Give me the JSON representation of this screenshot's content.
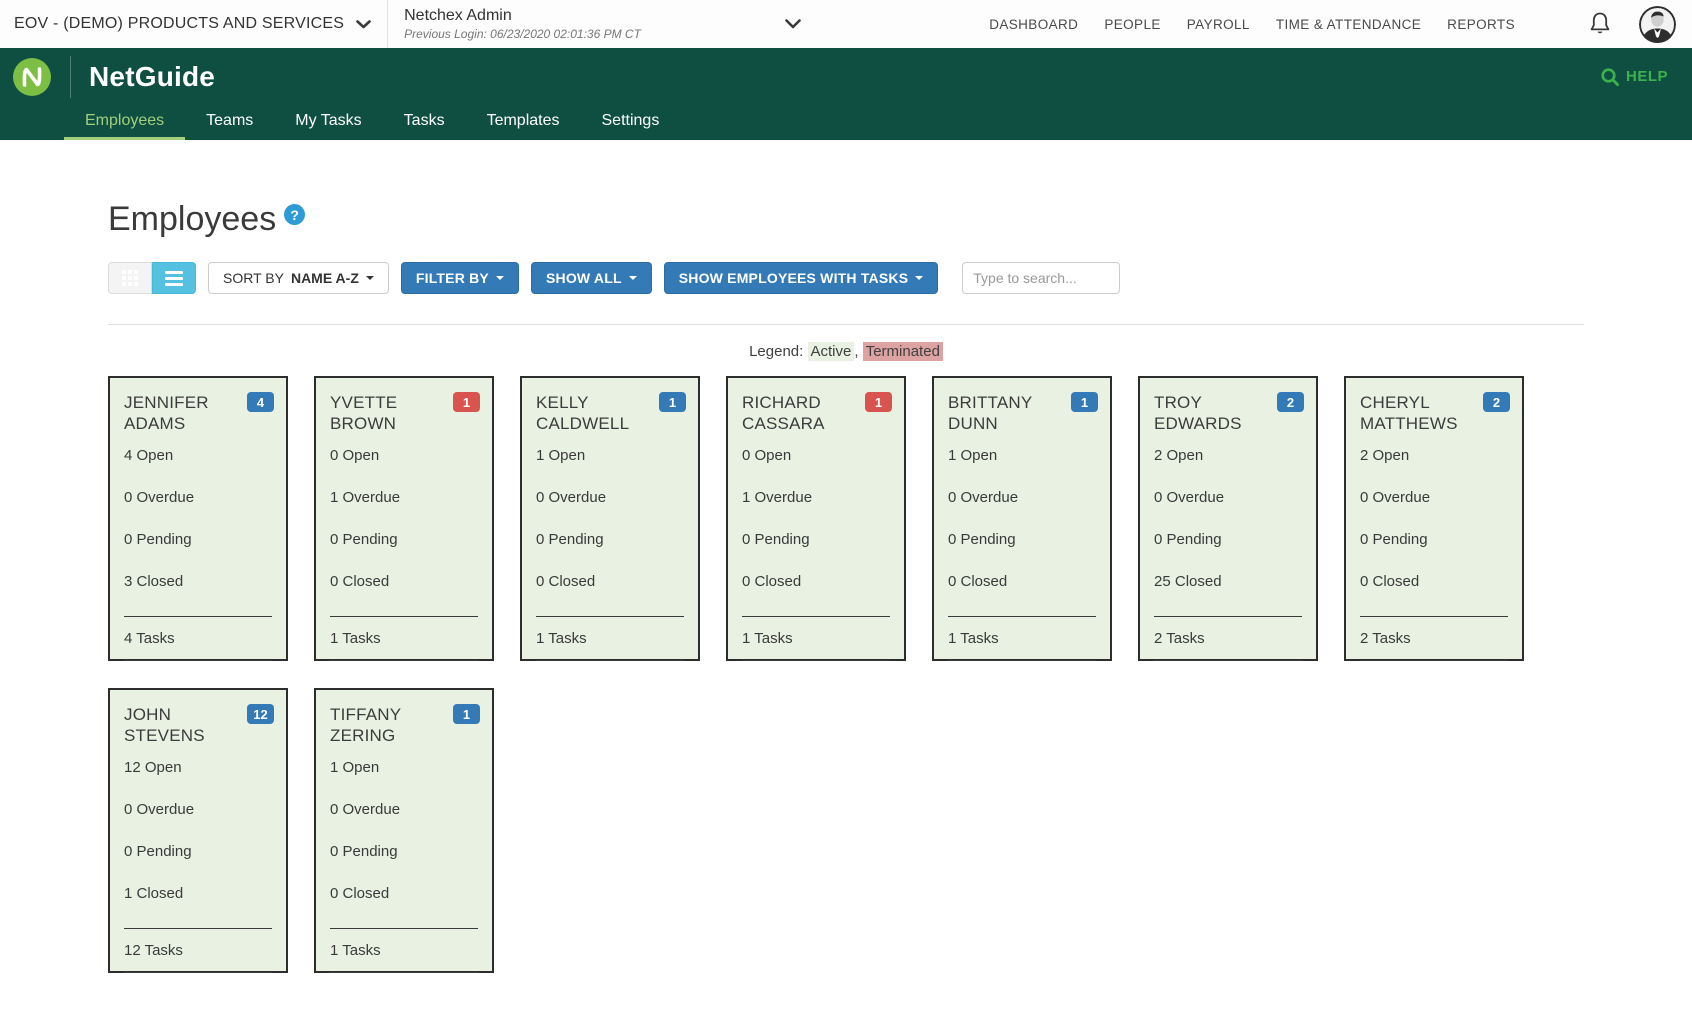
{
  "colors": {
    "header_green": "#0e4f41",
    "logo_green": "#7cbf44",
    "active_tab_green": "#a2cf7a",
    "help_green": "#3db24c",
    "primary_blue": "#337ab7",
    "list_toggle_blue": "#56c0e0",
    "badge_blue": "#337ab7",
    "badge_red": "#d9534f",
    "card_active_bg": "#e9f1e2",
    "legend_terminated_bg": "#dda3a3",
    "help_icon_blue": "#2e9bd6"
  },
  "top_bar": {
    "company_selector": "EOV - (DEMO) PRODUCTS AND SERVICES",
    "user_name": "Netchex Admin",
    "previous_login": "Previous Login: 06/23/2020 02:01:36 PM CT",
    "nav_items": [
      "DASHBOARD",
      "PEOPLE",
      "PAYROLL",
      "TIME & ATTENDANCE",
      "REPORTS"
    ]
  },
  "app_header": {
    "app_name": "NetGuide",
    "help_label": "HELP",
    "tabs": [
      {
        "label": "Employees",
        "active": true
      },
      {
        "label": "Teams",
        "active": false
      },
      {
        "label": "My Tasks",
        "active": false
      },
      {
        "label": "Tasks",
        "active": false
      },
      {
        "label": "Templates",
        "active": false
      },
      {
        "label": "Settings",
        "active": false
      }
    ]
  },
  "page": {
    "title": "Employees",
    "toolbar": {
      "sort_prefix": "SORT BY",
      "sort_value": "NAME A-Z",
      "filter_by": "FILTER BY",
      "show_all": "SHOW ALL",
      "show_employees_with_tasks": "SHOW EMPLOYEES WITH TASKS",
      "search_placeholder": "Type to search..."
    },
    "legend": {
      "prefix": "Legend:",
      "active_label": "Active",
      "separator": ", ",
      "terminated_label": "Terminated"
    }
  },
  "labels": {
    "open": "Open",
    "overdue": "Overdue",
    "pending": "Pending",
    "closed": "Closed",
    "tasks": "Tasks"
  },
  "employees": [
    {
      "name": "JENNIFER ADAMS",
      "badge": 4,
      "badge_style": "blue",
      "status": "active",
      "open": 4,
      "overdue": 0,
      "pending": 0,
      "closed": 3,
      "tasks": 4
    },
    {
      "name": "YVETTE BROWN",
      "badge": 1,
      "badge_style": "red",
      "status": "active",
      "open": 0,
      "overdue": 1,
      "pending": 0,
      "closed": 0,
      "tasks": 1
    },
    {
      "name": "KELLY CALDWELL",
      "badge": 1,
      "badge_style": "blue",
      "status": "active",
      "open": 1,
      "overdue": 0,
      "pending": 0,
      "closed": 0,
      "tasks": 1
    },
    {
      "name": "RICHARD CASSARA",
      "badge": 1,
      "badge_style": "red",
      "status": "active",
      "open": 0,
      "overdue": 1,
      "pending": 0,
      "closed": 0,
      "tasks": 1
    },
    {
      "name": "BRITTANY DUNN",
      "badge": 1,
      "badge_style": "blue",
      "status": "active",
      "open": 1,
      "overdue": 0,
      "pending": 0,
      "closed": 0,
      "tasks": 1
    },
    {
      "name": "TROY EDWARDS",
      "badge": 2,
      "badge_style": "blue",
      "status": "active",
      "open": 2,
      "overdue": 0,
      "pending": 0,
      "closed": 25,
      "tasks": 2
    },
    {
      "name": "CHERYL MATTHEWS",
      "badge": 2,
      "badge_style": "blue",
      "status": "active",
      "open": 2,
      "overdue": 0,
      "pending": 0,
      "closed": 0,
      "tasks": 2
    },
    {
      "name": "JOHN STEVENS",
      "badge": 12,
      "badge_style": "blue",
      "status": "active",
      "open": 12,
      "overdue": 0,
      "pending": 0,
      "closed": 1,
      "tasks": 12
    },
    {
      "name": "TIFFANY ZERING",
      "badge": 1,
      "badge_style": "blue",
      "status": "active",
      "open": 1,
      "overdue": 0,
      "pending": 0,
      "closed": 0,
      "tasks": 1
    }
  ]
}
